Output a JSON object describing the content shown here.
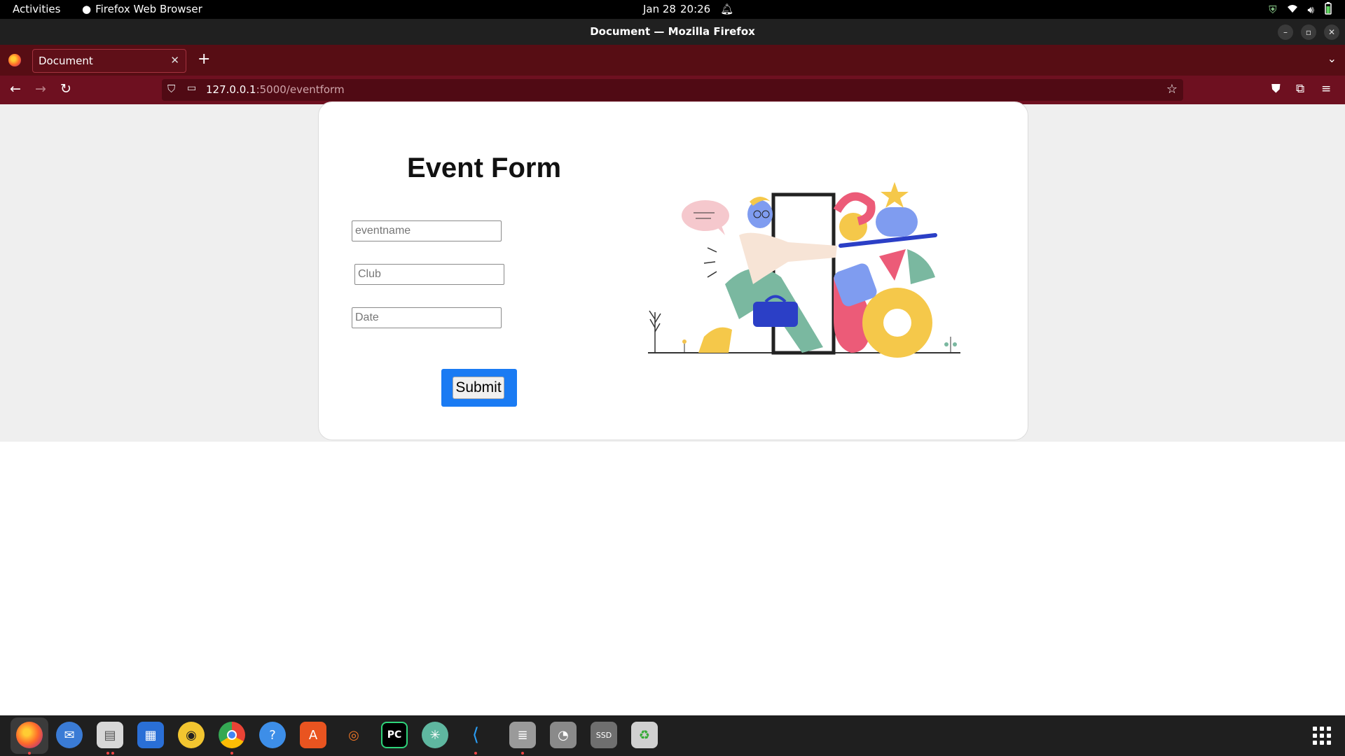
{
  "topbar": {
    "activities": "Activities",
    "app_name": "Firefox Web Browser",
    "date": "Jan 28",
    "time": "20:26"
  },
  "window": {
    "title": "Document — Mozilla Firefox"
  },
  "tabs": [
    {
      "label": "Document",
      "active": true
    }
  ],
  "urlbar": {
    "host": "127.0.0.1",
    "path": ":5000/eventform"
  },
  "form": {
    "title": "Event Form",
    "fields": [
      {
        "placeholder": "eventname",
        "value": ""
      },
      {
        "placeholder": "Club",
        "value": ""
      },
      {
        "placeholder": "Date",
        "value": ""
      }
    ],
    "submit_label": "Submit"
  },
  "dock": {
    "apps": [
      "firefox-icon",
      "thunderbird-icon",
      "files-icon",
      "writer-icon",
      "rhythmbox-icon",
      "chrome-icon",
      "help-icon",
      "app-center-icon",
      "jupyter-icon",
      "pycharm-icon",
      "chatgpt-icon",
      "vscode-icon",
      "database-icon",
      "disk-icon",
      "ssd-icon",
      "trash-icon"
    ],
    "app_grid": "show-apps-icon"
  },
  "colors": {
    "tab_strip": "#570d14",
    "nav_bar": "#6e1020",
    "submit_accent": "#1a7bf3"
  }
}
